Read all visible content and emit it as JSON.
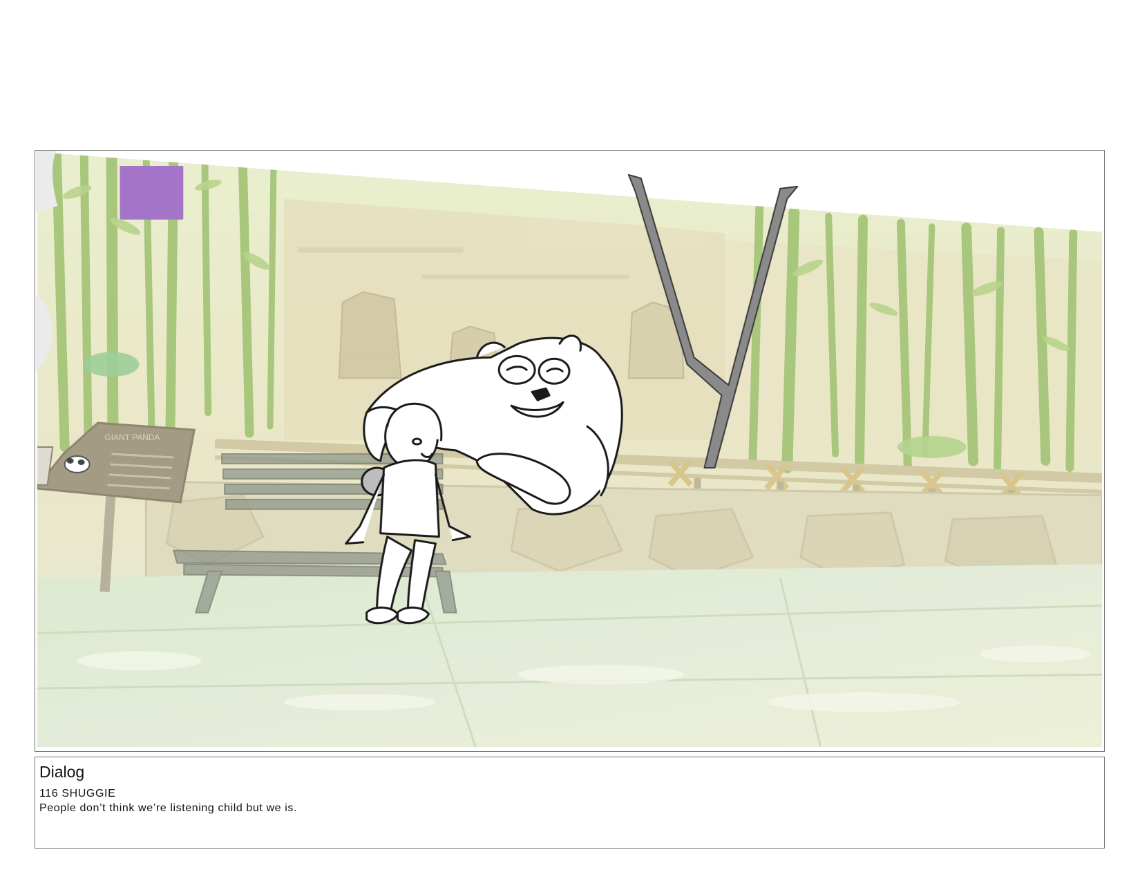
{
  "panel": {
    "marker_color": "#a374c8",
    "sign_text": "GIANT PANDA",
    "background_palette": {
      "sky": "#f2f0dc",
      "bamboo": "#a9c77a",
      "wall": "#e3ddbf",
      "floor": "#dfe9cf"
    }
  },
  "dialog": {
    "heading": "Dialog",
    "lines": [
      "116 SHUGGIE",
      "People don’t think we’re listening child but we is."
    ]
  }
}
